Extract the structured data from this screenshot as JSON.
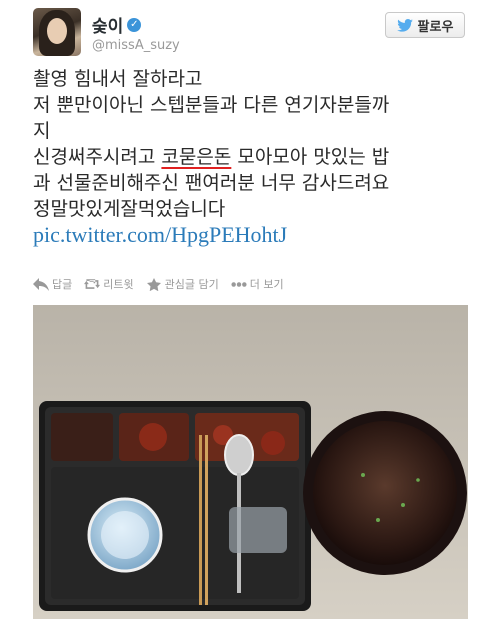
{
  "user": {
    "name": "숮이",
    "handle": "@missA_suzy",
    "verified": true
  },
  "follow_button": {
    "label": "팔로우",
    "icon": "twitter-bird-icon"
  },
  "tweet": {
    "lines": [
      "촬영 힘내서 잘하라고",
      "저 뿐만이아닌 스텝분들과 다른 연기자분들까",
      "지",
      "신경써주시려고 ",
      "코묻은돈",
      " 모아모아 맛있는 밥",
      "과 선물준비해주신 팬여러분 너무 감사드려요",
      "정말맛있게잘먹었습니다"
    ],
    "link": "pic.twitter.com/HpgPEHohtJ"
  },
  "actions": {
    "reply": "답글",
    "retweet": "리트윗",
    "favorite": "관심글 담기",
    "more": "더 보기"
  },
  "colors": {
    "link": "#2b7bb9",
    "verified": "#3b94d9",
    "underline": "#e02020"
  }
}
